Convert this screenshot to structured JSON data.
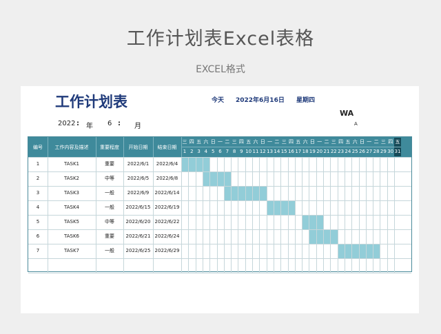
{
  "page": {
    "title": "工作计划表Excel表格",
    "subtitle": "EXCEL格式"
  },
  "sheet": {
    "title": "工作计划表",
    "today_label": "今天",
    "today_date": "2022年6月16日",
    "today_weekday": "星期四",
    "wa": "WA",
    "a_mark": "A",
    "year": "2022",
    "colon1": ":",
    "nian": "年",
    "month": "6",
    "colon2": ":",
    "yue": "月",
    "headers": [
      "编号",
      "工作内容及描述",
      "重要程度",
      "开始日期",
      "结束日期"
    ],
    "weekdays": [
      "三",
      "四",
      "五",
      "六",
      "日",
      "一",
      "二",
      "三",
      "四",
      "五",
      "六",
      "日",
      "一",
      "二",
      "三",
      "四",
      "五",
      "六",
      "日",
      "一",
      "二",
      "三",
      "四",
      "五",
      "六",
      "日",
      "一",
      "二",
      "三",
      "四",
      "五"
    ],
    "days": [
      "1",
      "2",
      "3",
      "4",
      "5",
      "6",
      "7",
      "8",
      "9",
      "10",
      "11",
      "12",
      "13",
      "14",
      "15",
      "16",
      "17",
      "18",
      "19",
      "20",
      "21",
      "22",
      "23",
      "24",
      "25",
      "26",
      "27",
      "28",
      "29",
      "30",
      "31"
    ],
    "tasks": [
      {
        "id": "1",
        "name": "TASK1",
        "priority": "重要",
        "start": "2022/6/1",
        "end": "2022/6/4",
        "from": 1,
        "to": 4
      },
      {
        "id": "2",
        "name": "TASK2",
        "priority": "中等",
        "start": "2022/6/5",
        "end": "2022/6/8",
        "from": 4,
        "to": 7
      },
      {
        "id": "3",
        "name": "TASK3",
        "priority": "一般",
        "start": "2022/6/9",
        "end": "2022/6/14",
        "from": 7,
        "to": 12
      },
      {
        "id": "4",
        "name": "TASK4",
        "priority": "一般",
        "start": "2022/6/15",
        "end": "2022/6/19",
        "from": 13,
        "to": 16
      },
      {
        "id": "5",
        "name": "TASK5",
        "priority": "中等",
        "start": "2022/6/20",
        "end": "2022/6/22",
        "from": 18,
        "to": 20
      },
      {
        "id": "6",
        "name": "TASK6",
        "priority": "重要",
        "start": "2022/6/21",
        "end": "2022/6/24",
        "from": 19,
        "to": 22
      },
      {
        "id": "7",
        "name": "TASK7",
        "priority": "一般",
        "start": "2022/6/25",
        "end": "2022/6/29",
        "from": 23,
        "to": 28
      }
    ],
    "colors": {
      "header": "#3f8a9b",
      "bar": "#92cdd8",
      "title": "#1f3a7a"
    }
  }
}
